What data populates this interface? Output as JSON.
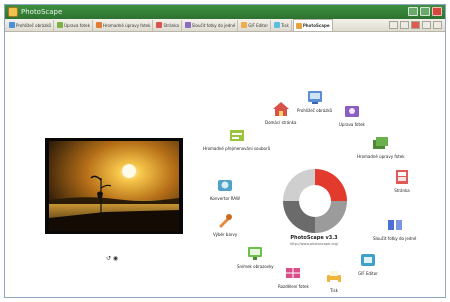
{
  "window": {
    "title": "PhotoScape"
  },
  "tabs": [
    {
      "label": "Prohlížeč obrázků",
      "color": "#4a90d9"
    },
    {
      "label": "Úprava fotek",
      "color": "#7bb241"
    },
    {
      "label": "Hromadné úpravy fotek",
      "color": "#e07b39"
    },
    {
      "label": "Stránka",
      "color": "#d9534f"
    },
    {
      "label": "Sloučit fotky do jedné",
      "color": "#8a6bbf"
    },
    {
      "label": "GIF Editor",
      "color": "#f0ad4e"
    },
    {
      "label": "Tisk",
      "color": "#5bc0de"
    },
    {
      "label": "PhotoScape",
      "color": "#e6a23c"
    }
  ],
  "nodes": {
    "prohlizec": {
      "label": "Prohlížeč obrázků",
      "color": "#5a8fd6"
    },
    "uprava": {
      "label": "Úprava fotek",
      "color": "#8a5fc1"
    },
    "hromadne": {
      "label": "Hromadné úpravy fotek",
      "color": "#6ab04c"
    },
    "stranka": {
      "label": "Stránka",
      "color": "#e05a5a"
    },
    "slouceni": {
      "label": "Sloučit fotky do jedné",
      "color": "#4a6fd6"
    },
    "gif": {
      "label": "GIF Editor",
      "color": "#3fa1c9"
    },
    "tisk": {
      "label": "Tisk",
      "color": "#f0b33c"
    },
    "rozdeleni": {
      "label": "Rozdělení fotek",
      "color": "#d94f8a"
    },
    "snimek": {
      "label": "Snímek obrazovky",
      "color": "#6cbf4a"
    },
    "barva": {
      "label": "Výběr barvy",
      "color": "#e8893a"
    },
    "prevod": {
      "label": "Konvertor RAW",
      "color": "#4fa3c7"
    },
    "prejmenovani": {
      "label": "Hromadné přejmenování souborů",
      "color": "#9bc43c"
    },
    "domaci": {
      "label": "Domácí stránka",
      "color": "#d9524a"
    }
  },
  "center": {
    "version": "PhotoScape v3.3",
    "url": "http://www.photoscape.org/"
  },
  "controls": {
    "rotate": "↺ ◉"
  }
}
